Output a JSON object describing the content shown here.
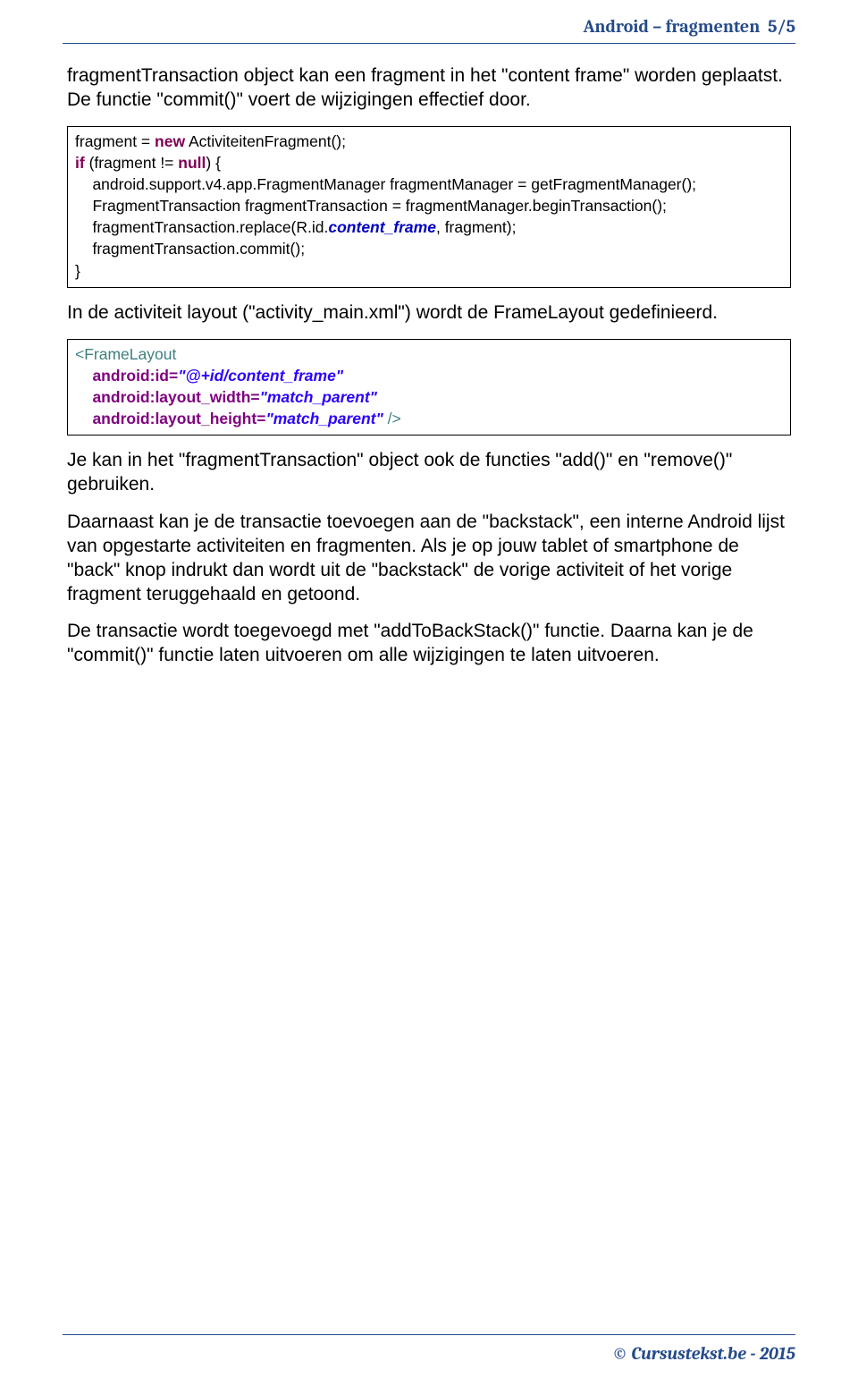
{
  "header": {
    "title": "Android – fragmenten",
    "page": "5/5"
  },
  "paragraphs": {
    "p1": "fragmentTransaction object kan een fragment in het \"content frame\" worden geplaatst. De functie \"commit()\" voert de wijzigingen effectief door.",
    "p2": "In de activiteit layout (\"activity_main.xml\") wordt de FrameLayout gedefinieerd.",
    "p3": "Je kan in het \"fragmentTransaction\" object ook de functies \"add()\" en \"remove()\" gebruiken.",
    "p4": "Daarnaast kan je de transactie toevoegen aan de \"backstack\", een interne Android lijst van opgestarte activiteiten en fragmenten. Als je op jouw tablet of smartphone de \"back\" knop indrukt dan wordt uit de \"backstack\" de vorige activiteit of het vorige fragment teruggehaald en getoond.",
    "p5": "De transactie wordt toegevoegd met \"addToBackStack()\" functie. Daarna kan je de \"commit()\" functie laten uitvoeren om alle wijzigingen te laten uitvoeren."
  },
  "code1": {
    "l1a": "fragment = ",
    "l1_new": "new",
    "l1b": " ActiviteitenFragment();",
    "l2_if": "if",
    "l2a": " (fragment != ",
    "l2_null": "null",
    "l2b": ") {",
    "l3": "    android.support.v4.app.FragmentManager fragmentManager = getFragmentManager();",
    "l4": "    FragmentTransaction fragmentTransaction = fragmentManager.beginTransaction();",
    "l5a": "    fragmentTransaction.replace(R.id.",
    "l5_fld": "content_frame",
    "l5b": ", fragment);",
    "l6": "    fragmentTransaction.commit();",
    "l7": "}"
  },
  "code2": {
    "lt": "<",
    "gt": "/>",
    "tag": "FrameLayout",
    "a1": "android:id=",
    "v1": "\"@+id/content_frame\"",
    "a2": "android:layout_width=",
    "v2": "\"match_parent\"",
    "a3": "android:layout_height=",
    "v3": "\"match_parent\" "
  },
  "footer": "© Cursustekst.be - 2015"
}
